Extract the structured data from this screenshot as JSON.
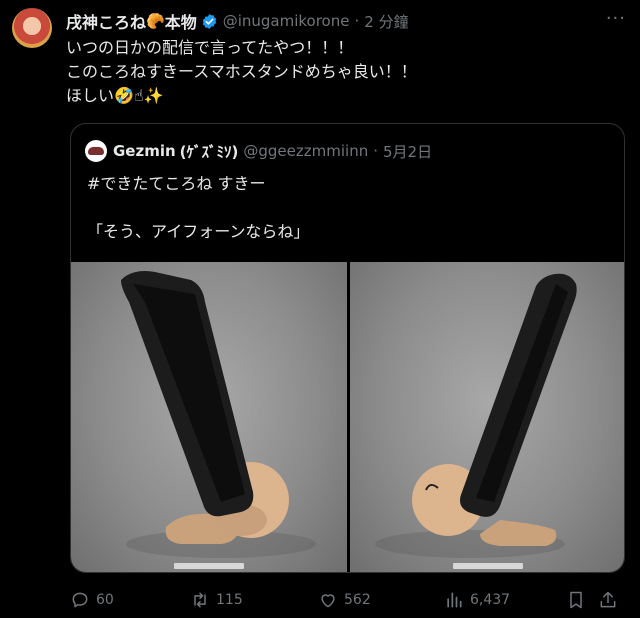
{
  "tweet": {
    "author_name": "戌神ころね",
    "author_tag": "本物",
    "handle": "@inugamikorone",
    "separator": "·",
    "time": "2 分鐘",
    "text": "いつの日かの配信で言ってたやつ！！！\nこのころねすきースマホスタンドめちゃ良い！！\nほしい"
  },
  "quote": {
    "author_name": "Gezmin",
    "author_name_suffix": "(ｹﾞｽﾞﾐｿ)",
    "handle": "@ggeezzmmiinn",
    "separator": "·",
    "date": "5月2日",
    "text": "#できたてころね すきー\n\n「そう、アイフォーンならね」"
  },
  "actions": {
    "replies": "60",
    "reposts": "115",
    "likes": "562",
    "views": "6,437"
  },
  "colors": {
    "background": "#000000",
    "text": "#e7e9ea",
    "muted": "#71767b",
    "verified": "#1d9bf0",
    "border": "#2f3336"
  },
  "icons": [
    "croissant-icon",
    "verified-badge-icon",
    "more-icon",
    "rofl-emoji-icon",
    "pointing-up-emoji-icon",
    "sparkles-emoji-icon",
    "reply-icon",
    "repost-icon",
    "like-icon",
    "views-icon",
    "bookmark-icon",
    "share-icon"
  ]
}
